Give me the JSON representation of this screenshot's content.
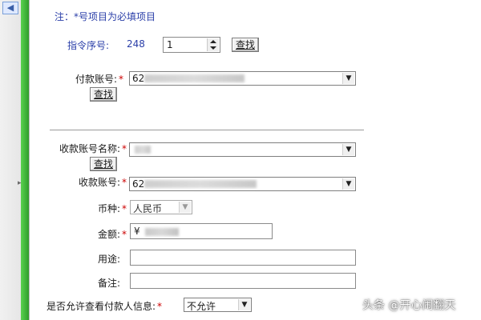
{
  "form": {
    "note": "注：*号项目为必填项目",
    "command_no_label": "指令序号:",
    "command_no_value": "248",
    "stepper_value": "1",
    "find_label": "查找",
    "payer_account_label": "付款账号:",
    "payer_account_prefix": "62",
    "payee_name_label": "收款账号名称:",
    "payee_account_label": "收款账号:",
    "payee_account_prefix": "62",
    "currency_label": "币种:",
    "currency_value": "人民币",
    "amount_label": "金额:",
    "amount_prefix": "¥",
    "purpose_label": "用途:",
    "remark_label": "备注:",
    "allow_view_label": "是否允许查看付款人信息:",
    "allow_view_value": "不允许",
    "required_mark": "*"
  },
  "watermark": "头条 @开心闹翻天"
}
